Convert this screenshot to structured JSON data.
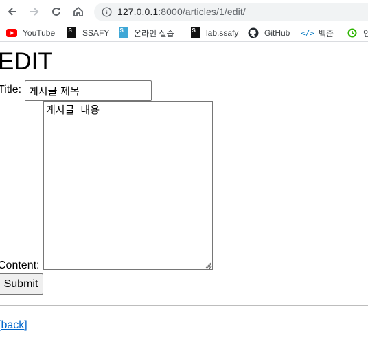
{
  "browser": {
    "url_host": "127.0.0.1",
    "url_path": ":8000/articles/1/edit/"
  },
  "bookmarks": [
    {
      "label": "YouTube",
      "icon": "youtube-icon"
    },
    {
      "label": "SSAFY",
      "icon": "ssafy-icon"
    },
    {
      "label": "온라인 실습",
      "icon": "ssafy-online-icon"
    },
    {
      "label": "lab.ssafy",
      "icon": "ssafy-lab-icon"
    },
    {
      "label": "GitHub",
      "icon": "github-icon"
    },
    {
      "label": "백준",
      "icon": "baekjoon-icon"
    },
    {
      "label": "인",
      "icon": "green-circle-icon"
    }
  ],
  "page": {
    "heading": "EDIT",
    "title_label": "Title:",
    "title_value": "게시글 제목",
    "content_label": "Content:",
    "content_value": "게시글 내용",
    "submit_label": "Submit",
    "back_link": "[back]"
  },
  "colors": {
    "link": "#0066cc",
    "youtube": "#ff0000",
    "omnibox_bg": "#f1f3f4"
  }
}
